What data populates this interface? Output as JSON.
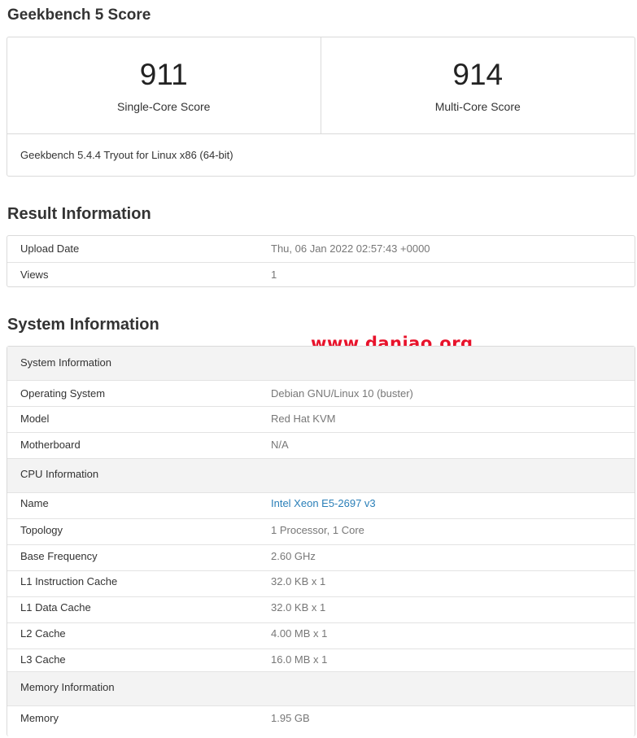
{
  "score_section": {
    "title": "Geekbench 5 Score",
    "single_core": {
      "score": "911",
      "label": "Single-Core Score"
    },
    "multi_core": {
      "score": "914",
      "label": "Multi-Core Score"
    },
    "version": "Geekbench 5.4.4 Tryout for Linux x86 (64-bit)"
  },
  "result_section": {
    "title": "Result Information",
    "rows": [
      {
        "key": "Upload Date",
        "value": "Thu, 06 Jan 2022 02:57:43 +0000"
      },
      {
        "key": "Views",
        "value": "1"
      }
    ]
  },
  "system_section": {
    "title": "System Information",
    "groups": [
      {
        "header": "System Information",
        "rows": [
          {
            "key": "Operating System",
            "value": "Debian GNU/Linux 10 (buster)"
          },
          {
            "key": "Model",
            "value": "Red Hat KVM"
          },
          {
            "key": "Motherboard",
            "value": "N/A"
          }
        ]
      },
      {
        "header": "CPU Information",
        "rows": [
          {
            "key": "Name",
            "value": "Intel Xeon E5-2697 v3"
          },
          {
            "key": "Topology",
            "value": "1 Processor, 1 Core"
          },
          {
            "key": "Base Frequency",
            "value": "2.60 GHz"
          },
          {
            "key": "L1 Instruction Cache",
            "value": "32.0 KB x 1"
          },
          {
            "key": "L1 Data Cache",
            "value": "32.0 KB x 1"
          },
          {
            "key": "L2 Cache",
            "value": "4.00 MB x 1"
          },
          {
            "key": "L3 Cache",
            "value": "16.0 MB x 1"
          }
        ]
      },
      {
        "header": "Memory Information",
        "rows": [
          {
            "key": "Memory",
            "value": "1.95 GB"
          }
        ]
      }
    ]
  },
  "watermark": "www.daniao.org",
  "colors": {
    "link": "#2a7fb8",
    "watermark": "#e8132b",
    "section_bg": "#f3f3f3"
  }
}
